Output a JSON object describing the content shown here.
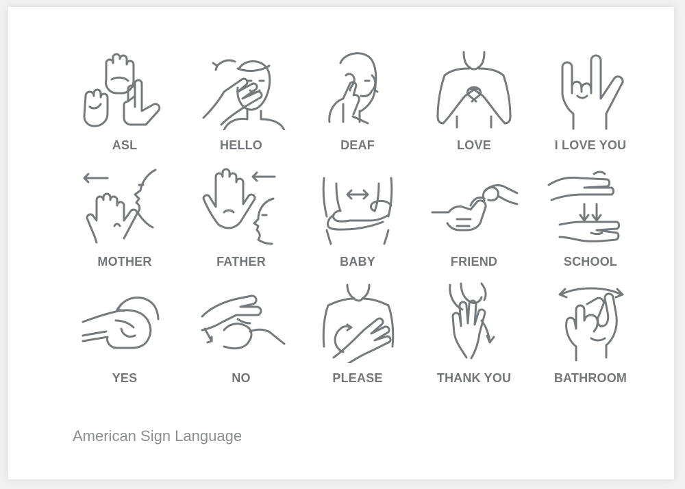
{
  "signs": [
    {
      "label": "ASL",
      "icon": "asl-hands-icon"
    },
    {
      "label": "HELLO",
      "icon": "hello-salute-icon"
    },
    {
      "label": "DEAF",
      "icon": "deaf-touch-ear-icon"
    },
    {
      "label": "LOVE",
      "icon": "love-crossed-arms-icon"
    },
    {
      "label": "I LOVE YOU",
      "icon": "i-love-you-hand-icon"
    },
    {
      "label": "MOTHER",
      "icon": "mother-thumb-chin-icon"
    },
    {
      "label": "FATHER",
      "icon": "father-thumb-forehead-icon"
    },
    {
      "label": "BABY",
      "icon": "baby-rocking-arms-icon"
    },
    {
      "label": "FRIEND",
      "icon": "friend-hooked-fingers-icon"
    },
    {
      "label": "SCHOOL",
      "icon": "school-clapping-hands-icon"
    },
    {
      "label": "YES",
      "icon": "yes-nodding-fist-icon"
    },
    {
      "label": "NO",
      "icon": "no-snapping-fingers-icon"
    },
    {
      "label": "PLEASE",
      "icon": "please-circle-chest-icon"
    },
    {
      "label": "THANK YOU",
      "icon": "thank-you-chin-hand-icon"
    },
    {
      "label": "BATHROOM",
      "icon": "bathroom-shaking-t-icon"
    }
  ],
  "footer": "American Sign Language",
  "colors": {
    "background": "#f1f1f1",
    "card": "#ffffff",
    "line": "#777a7d",
    "label": "#747679",
    "footer": "#8c8e90"
  }
}
